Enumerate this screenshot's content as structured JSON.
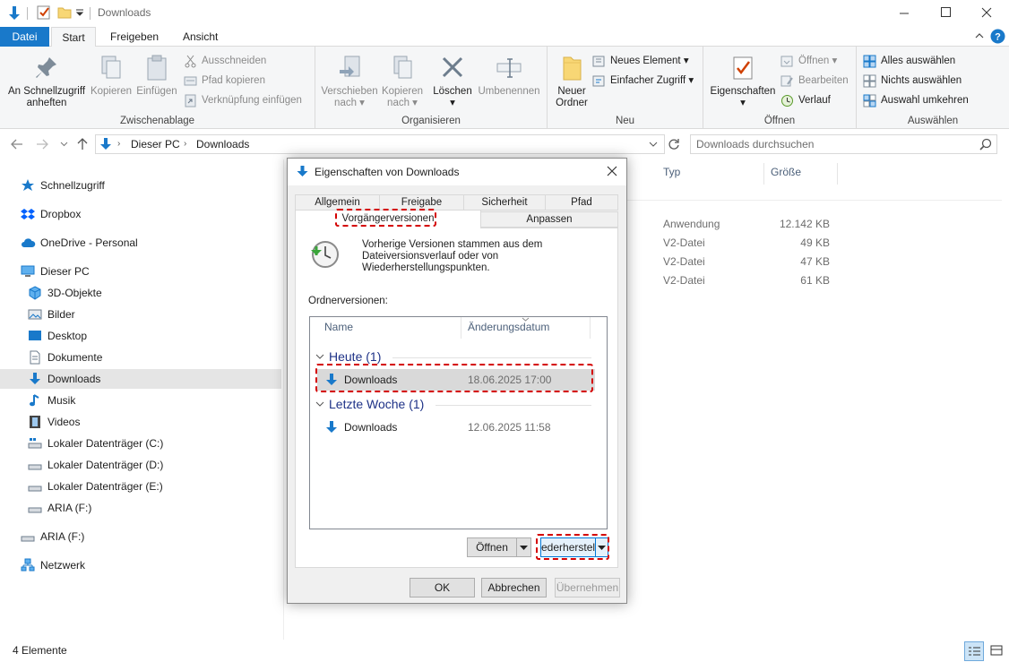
{
  "window": {
    "title": "Downloads",
    "controls": [
      "minimize-icon",
      "maximize-icon",
      "close-icon"
    ]
  },
  "ribbon_tabs": [
    "Datei",
    "Start",
    "Freigeben",
    "Ansicht"
  ],
  "ribbon": {
    "clipboard": {
      "pin_line1": "An Schnellzugriff",
      "pin_line2": "anheften",
      "copy": "Kopieren",
      "paste": "Einfügen",
      "cut": "Ausschneiden",
      "copy_path": "Pfad kopieren",
      "paste_shortcut": "Verknüpfung einfügen",
      "label": "Zwischenablage"
    },
    "organize": {
      "move_line1": "Verschieben",
      "move_line2": "nach",
      "copyto_line1": "Kopieren",
      "copyto_line2": "nach",
      "delete": "Löschen",
      "rename": "Umbenennen",
      "label": "Organisieren"
    },
    "new": {
      "folder_line1": "Neuer",
      "folder_line2": "Ordner",
      "new_item": "Neues Element",
      "easy_access": "Einfacher Zugriff",
      "label": "Neu"
    },
    "open": {
      "properties": "Eigenschaften",
      "open": "Öffnen",
      "edit": "Bearbeiten",
      "history": "Verlauf",
      "label": "Öffnen"
    },
    "select": {
      "select_all": "Alles auswählen",
      "select_none": "Nichts auswählen",
      "invert": "Auswahl umkehren",
      "label": "Auswählen"
    }
  },
  "address": {
    "crumbs": [
      "Dieser PC",
      "Downloads"
    ],
    "search_placeholder": "Downloads durchsuchen"
  },
  "nav": {
    "quick_access": "Schnellzugriff",
    "dropbox": "Dropbox",
    "onedrive": "OneDrive - Personal",
    "this_pc": "Dieser PC",
    "objects3d": "3D-Objekte",
    "pictures": "Bilder",
    "desktop": "Desktop",
    "documents": "Dokumente",
    "downloads": "Downloads",
    "music": "Musik",
    "videos": "Videos",
    "drive_c": "Lokaler Datenträger (C:)",
    "drive_d": "Lokaler Datenträger (D:)",
    "drive_e": "Lokaler Datenträger (E:)",
    "aria_f1": "ARIA (F:)",
    "aria_f2": "ARIA (F:)",
    "network": "Netzwerk"
  },
  "filelist": {
    "columns": {
      "type": "Typ",
      "size": "Größe"
    },
    "rows": [
      {
        "type": "Anwendung",
        "size": "12.142 KB"
      },
      {
        "type": "V2-Datei",
        "size": "49 KB"
      },
      {
        "type": "V2-Datei",
        "size": "47 KB"
      },
      {
        "type": "V2-Datei",
        "size": "61 KB"
      }
    ]
  },
  "status": {
    "count": "4 Elemente"
  },
  "dialog": {
    "title": "Eigenschaften von Downloads",
    "tabs_row1": [
      "Allgemein",
      "Freigabe",
      "Sicherheit",
      "Pfad"
    ],
    "tabs_row2": [
      "Vorgängerversionen",
      "Anpassen"
    ],
    "info_line1": "Vorherige Versionen stammen aus dem",
    "info_line2": "Dateiversionsverlauf oder von",
    "info_line3": "Wiederherstellungspunkten.",
    "versions_label": "Ordnerversionen:",
    "columns": {
      "name": "Name",
      "date": "Änderungsdatum"
    },
    "groups": [
      {
        "title": "Heute (1)",
        "items": [
          {
            "name": "Downloads",
            "date": "18.06.2025 17:00",
            "selected": true
          }
        ]
      },
      {
        "title": "Letzte Woche (1)",
        "items": [
          {
            "name": "Downloads",
            "date": "12.06.2025 11:58",
            "selected": false
          }
        ]
      }
    ],
    "open_button": "Öffnen",
    "restore_button": "ederherstell",
    "ok": "OK",
    "cancel": "Abbrechen",
    "apply": "Übernehmen"
  },
  "colors": {
    "accent": "#1979ca",
    "highlight": "#d40000",
    "folder": "#f8d775"
  }
}
